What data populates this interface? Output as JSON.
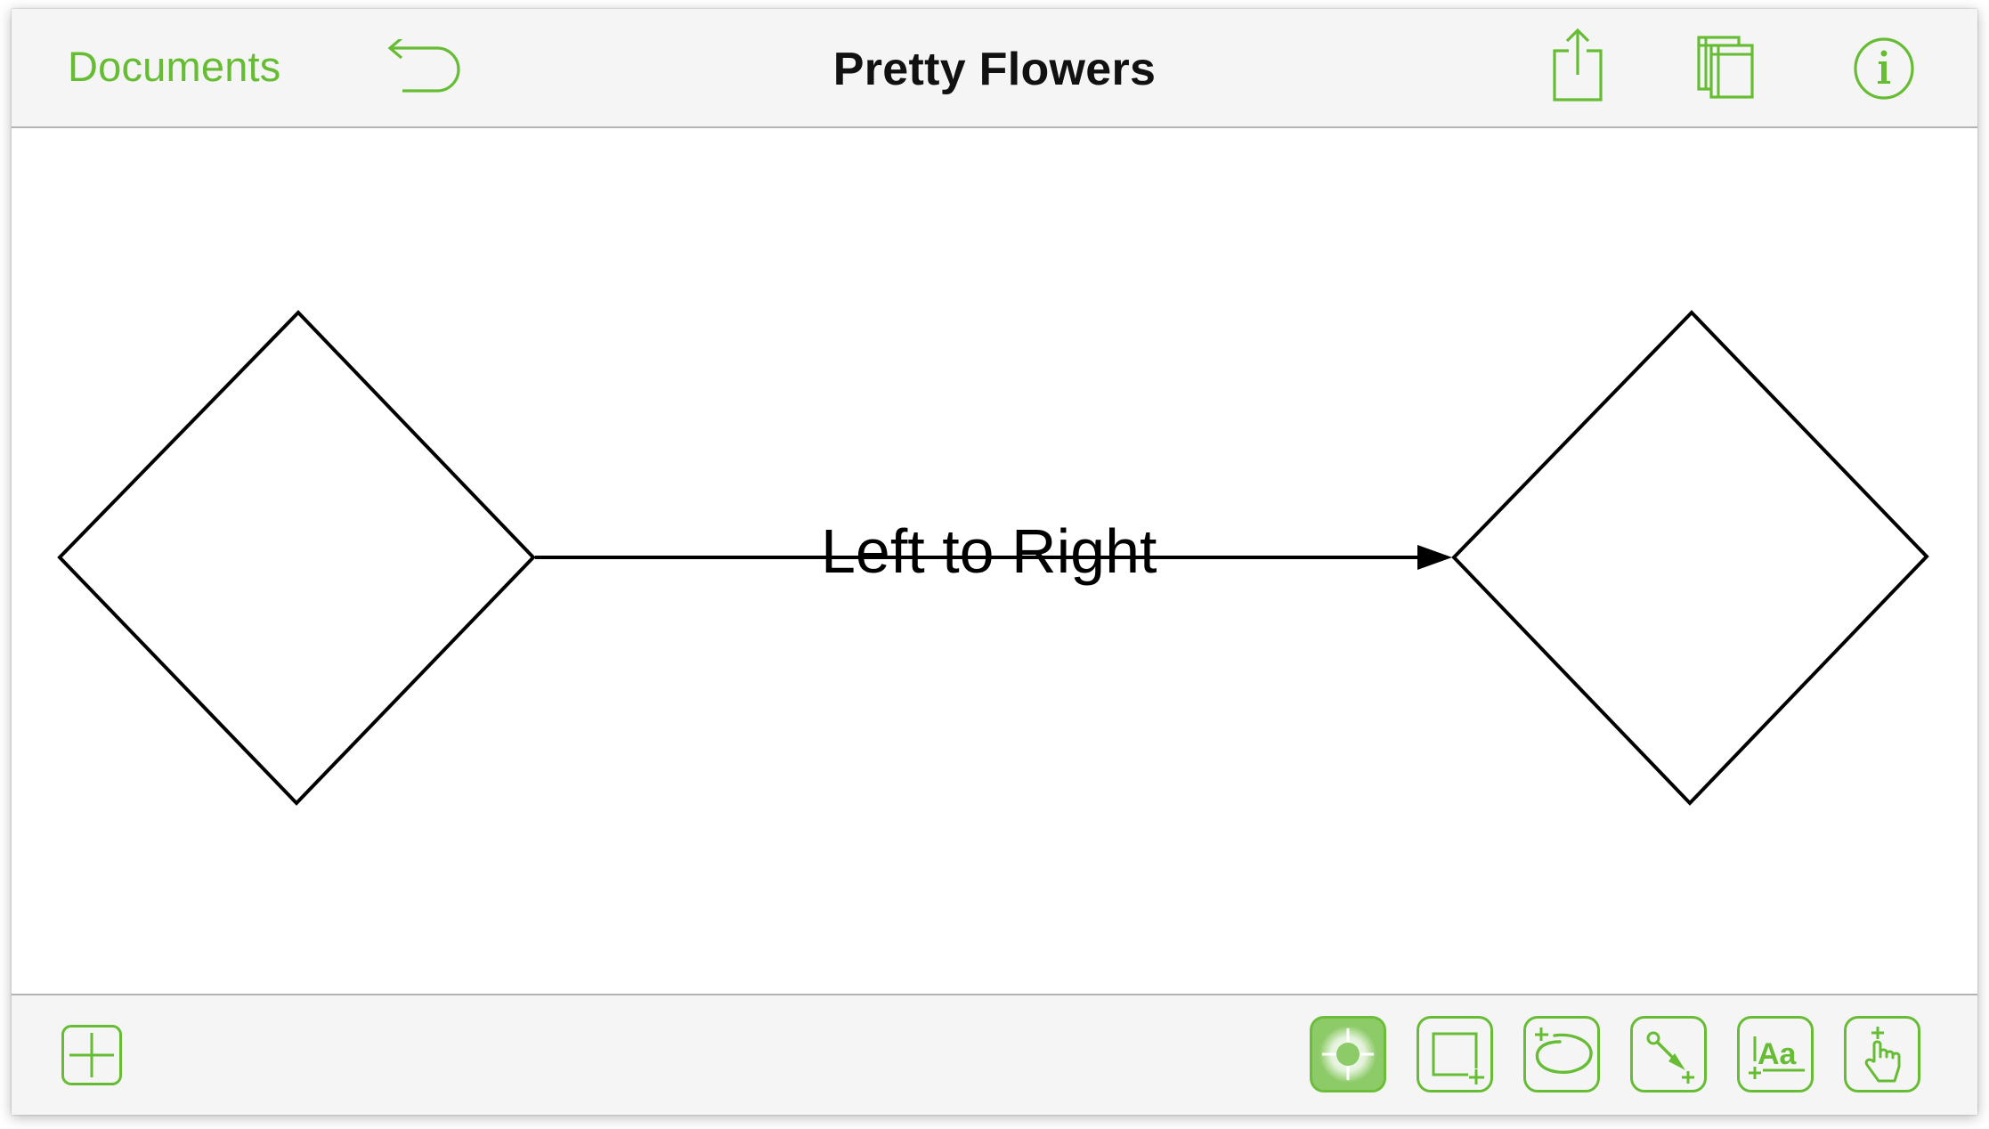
{
  "app": {
    "accent_color": "#66bd34",
    "selected_tool_fill": "#8dcb68"
  },
  "topbar": {
    "documents_label": "Documents",
    "title": "Pretty Flowers",
    "icons": {
      "undo": "undo-icon",
      "share": "share-icon",
      "layers": "layers-icon",
      "info": "info-icon"
    }
  },
  "canvas": {
    "shapes": [
      {
        "type": "diamond",
        "name": "left-diamond"
      },
      {
        "type": "diamond",
        "name": "right-diamond"
      }
    ],
    "connector": {
      "from": "left-diamond",
      "to": "right-diamond",
      "direction": "left-to-right",
      "arrowhead": "filled-triangle",
      "label": "Left to Right"
    }
  },
  "bottombar": {
    "add_button": "add-icon",
    "tools": [
      {
        "name": "selection-tool",
        "icon": "crosshair-icon",
        "selected": true
      },
      {
        "name": "shape-tool",
        "icon": "rectangle-plus-icon",
        "selected": false
      },
      {
        "name": "freehand-tool",
        "icon": "lasso-plus-icon",
        "selected": false
      },
      {
        "name": "line-tool",
        "icon": "connector-arrow-icon",
        "selected": false
      },
      {
        "name": "text-tool",
        "icon": "text-aa-icon",
        "glyph": "Aa",
        "selected": false
      },
      {
        "name": "touch-tool",
        "icon": "hand-pointer-icon",
        "selected": false
      }
    ]
  }
}
